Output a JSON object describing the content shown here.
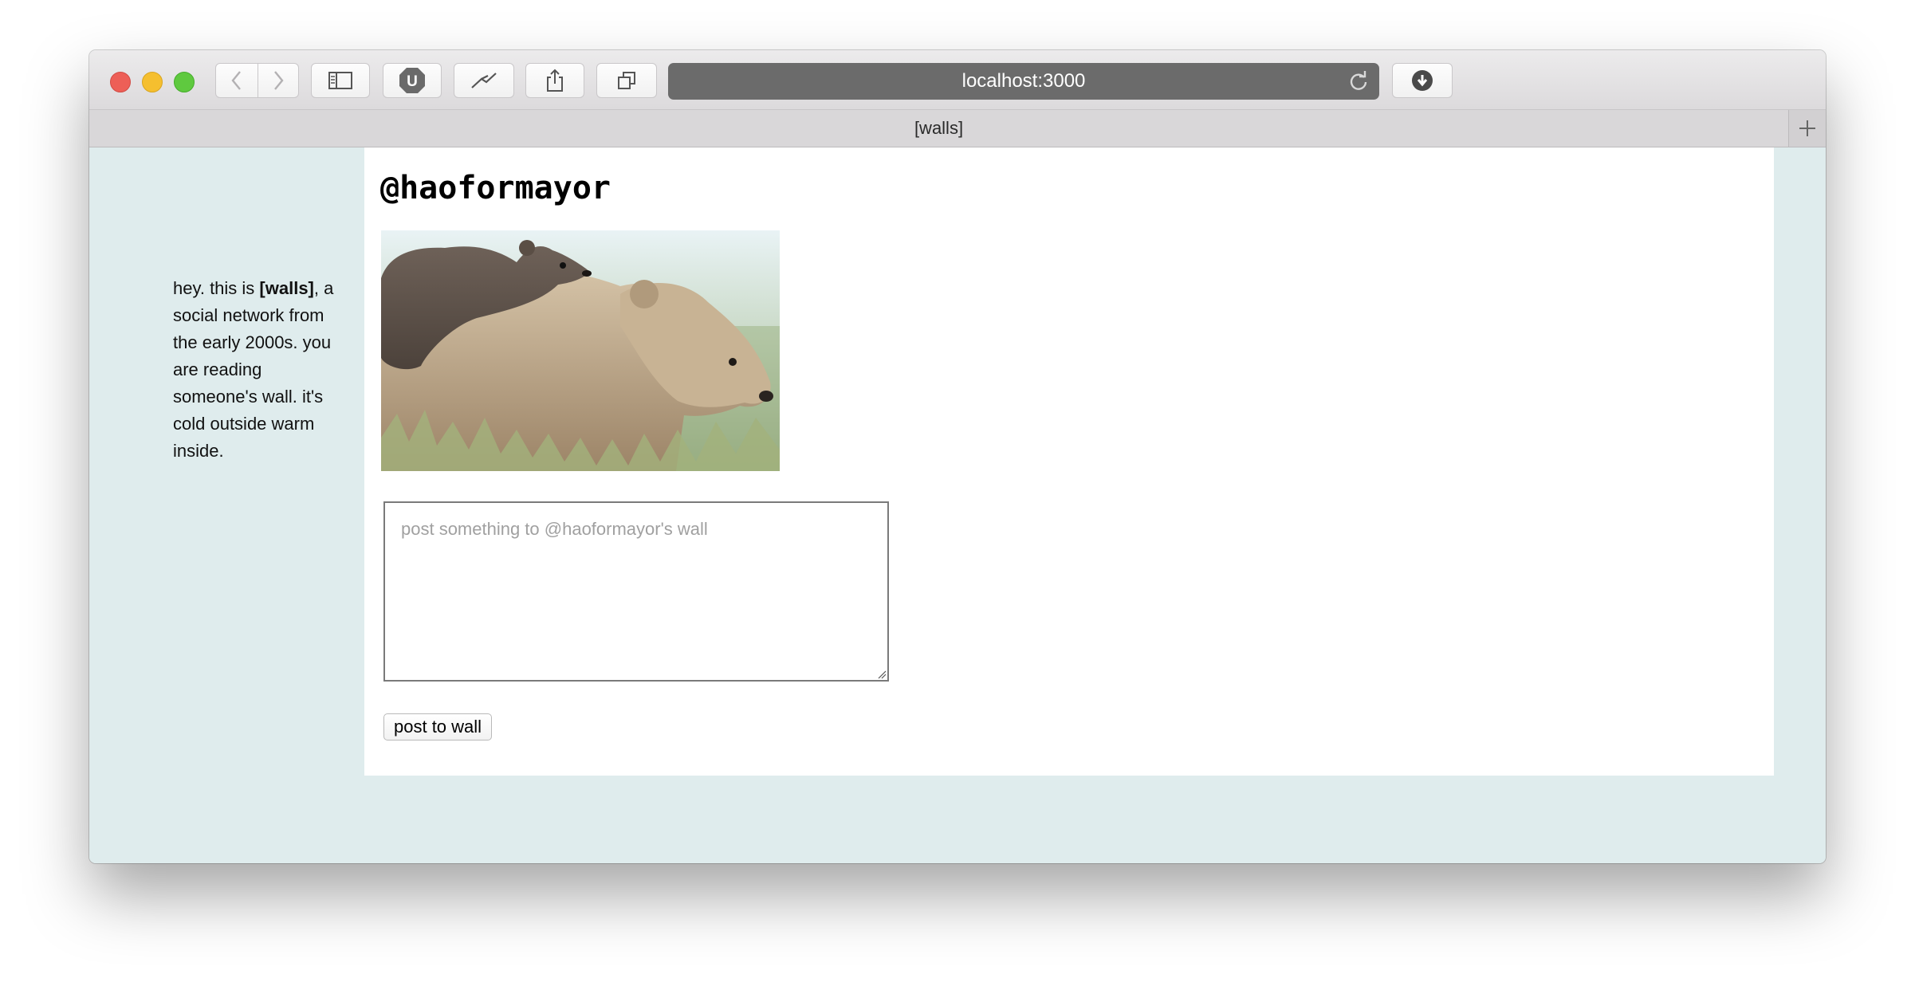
{
  "browser": {
    "url": "localhost:3000",
    "tab_title": "[walls]"
  },
  "sidebar": {
    "text_before": "hey. this is ",
    "brand": "[walls]",
    "text_after": ", a social network from the early 2000s. you are reading someone's wall. it's cold outside warm inside."
  },
  "wall": {
    "handle": "@haoformayor",
    "photo_alt": "mother bear with cub on back",
    "post_placeholder": "post something to @haoformayor's wall",
    "post_button_label": "post to wall"
  },
  "colors": {
    "page_background": "#dfeced",
    "wall_background": "#ffffff",
    "url_bar": "#6b6b6b"
  },
  "icons": [
    "back-icon",
    "forward-icon",
    "sidebar-icon",
    "ublock-icon",
    "pin-icon",
    "share-icon",
    "tabs-icon",
    "reload-icon",
    "download-icon",
    "new-tab-icon"
  ]
}
